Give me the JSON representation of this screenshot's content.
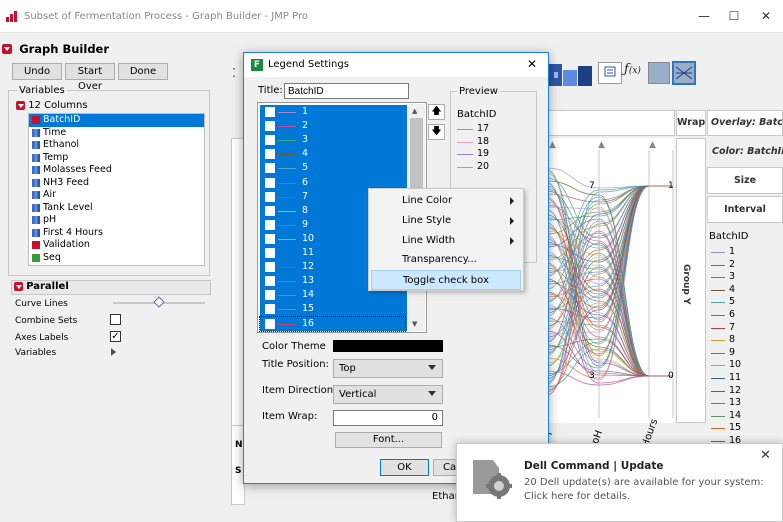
{
  "window": {
    "title": "Subset of Fermentation Process - Graph Builder - JMP Pro",
    "minimize": "—",
    "maximize": "☐",
    "close": "✕"
  },
  "graph_builder": {
    "header": "Graph Builder",
    "buttons": {
      "undo": "Undo",
      "start_over": "Start Over",
      "done": "Done"
    },
    "variables_label": "Variables",
    "columns_label": "12 Columns",
    "columns": [
      {
        "name": "BatchID",
        "type": "nominal",
        "selected": true
      },
      {
        "name": "Time",
        "type": "continuous"
      },
      {
        "name": "Ethanol",
        "type": "continuous"
      },
      {
        "name": "Temp",
        "type": "continuous"
      },
      {
        "name": "Molasses Feed",
        "type": "continuous"
      },
      {
        "name": "NH3 Feed",
        "type": "continuous"
      },
      {
        "name": "Air",
        "type": "continuous"
      },
      {
        "name": "Tank Level",
        "type": "continuous"
      },
      {
        "name": "pH",
        "type": "continuous"
      },
      {
        "name": "First 4 Hours",
        "type": "continuous"
      },
      {
        "name": "Validation",
        "type": "nominal"
      },
      {
        "name": "Seq",
        "type": "ordinal"
      }
    ],
    "parallel": {
      "title": "Parallel",
      "curve_lines": "Curve Lines",
      "curve_lines_value": 0.5,
      "combine_sets": "Combine Sets",
      "combine_sets_checked": false,
      "axes_labels": "Axes Labels",
      "axes_labels_checked": true,
      "variables": "Variables"
    },
    "zones": {
      "wrap": "Wrap",
      "overlay": "Overlay: BatchID",
      "color": "Color: BatchID",
      "size": "Size",
      "interval": "Interval",
      "group_y": "Group Y",
      "x_label": "Ethan",
      "axis_label_ph": "pH",
      "axis_label_hours": "Hours",
      "axis_label_l": "l",
      "tick_7": "7",
      "tick_3": "3",
      "tick_1": "1",
      "tick_0": "0",
      "left_zone_n": "N",
      "left_zone_s": "S"
    },
    "legend": {
      "title": "BatchID",
      "items": [
        {
          "label": "1",
          "color": "#9b8ad8"
        },
        {
          "label": "2",
          "color": "#b04a8a"
        },
        {
          "label": "3",
          "color": "#2e9a6a"
        },
        {
          "label": "4",
          "color": "#6b5a2a"
        },
        {
          "label": "5",
          "color": "#4a9ac8"
        },
        {
          "label": "6",
          "color": "#3a8a8a"
        },
        {
          "label": "7",
          "color": "#c04040"
        },
        {
          "label": "8",
          "color": "#d8a030"
        },
        {
          "label": "9",
          "color": "#5a8a3a"
        },
        {
          "label": "10",
          "color": "#9a9ad8"
        },
        {
          "label": "11",
          "color": "#3a5aa8"
        },
        {
          "label": "12",
          "color": "#7a4a9a"
        },
        {
          "label": "13",
          "color": "#3a8aa8"
        },
        {
          "label": "14",
          "color": "#5a9a5a"
        },
        {
          "label": "15",
          "color": "#d86a2a"
        },
        {
          "label": "16",
          "color": "#c03a6a"
        }
      ]
    }
  },
  "dialog": {
    "title": "Legend Settings",
    "close": "✕",
    "title_label": "Title:",
    "title_value": "BatchID",
    "items": [
      {
        "label": "1",
        "color": "#a88ae0"
      },
      {
        "label": "2",
        "color": "#c050a0"
      },
      {
        "label": "3",
        "color": "#3aaa7a"
      },
      {
        "label": "4",
        "color": "#6a5a30"
      },
      {
        "label": "5",
        "color": "#50a0d0"
      },
      {
        "label": "6",
        "color": "#3a9090"
      },
      {
        "label": "7",
        "color": "#c84848"
      },
      {
        "label": "8",
        "color": "#e0a838"
      },
      {
        "label": "9",
        "color": "#60903a"
      },
      {
        "label": "10",
        "color": "#a0a0e0"
      },
      {
        "label": "11",
        "color": "#4060b0"
      },
      {
        "label": "12",
        "color": "#8050a0"
      },
      {
        "label": "13",
        "color": "#4090b0"
      },
      {
        "label": "14",
        "color": "#60a060"
      },
      {
        "label": "15",
        "color": "#e07030"
      },
      {
        "label": "16",
        "color": "#c84070"
      }
    ],
    "preview_label": "Preview",
    "preview_title": "BatchID",
    "preview_items": [
      {
        "label": "17",
        "color": "#3ac8a0"
      },
      {
        "label": "18",
        "color": "#e0a0c0"
      },
      {
        "label": "19",
        "color": "#a080c0"
      },
      {
        "label": "20",
        "color": "#c0a060"
      }
    ],
    "color_theme_label": "Color Theme",
    "title_position_label": "Title Position:",
    "title_position_value": "Top",
    "item_direction_label": "Item Direction:",
    "item_direction_value": "Vertical",
    "item_wrap_label": "Item Wrap:",
    "item_wrap_value": "0",
    "font_button": "Font...",
    "ok_button": "OK",
    "cancel_button": "Car"
  },
  "context_menu": {
    "items": [
      {
        "label": "Line Color",
        "submenu": true
      },
      {
        "label": "Line Style",
        "submenu": true
      },
      {
        "label": "Line Width",
        "submenu": true
      },
      {
        "label": "Transparency...",
        "submenu": false
      },
      {
        "label": "Toggle check box",
        "submenu": false,
        "highlighted": true
      }
    ]
  },
  "notification": {
    "title": "Dell Command | Update",
    "body": "20 Dell update(s) are available for your system: Click here for details.",
    "close": "✕"
  }
}
